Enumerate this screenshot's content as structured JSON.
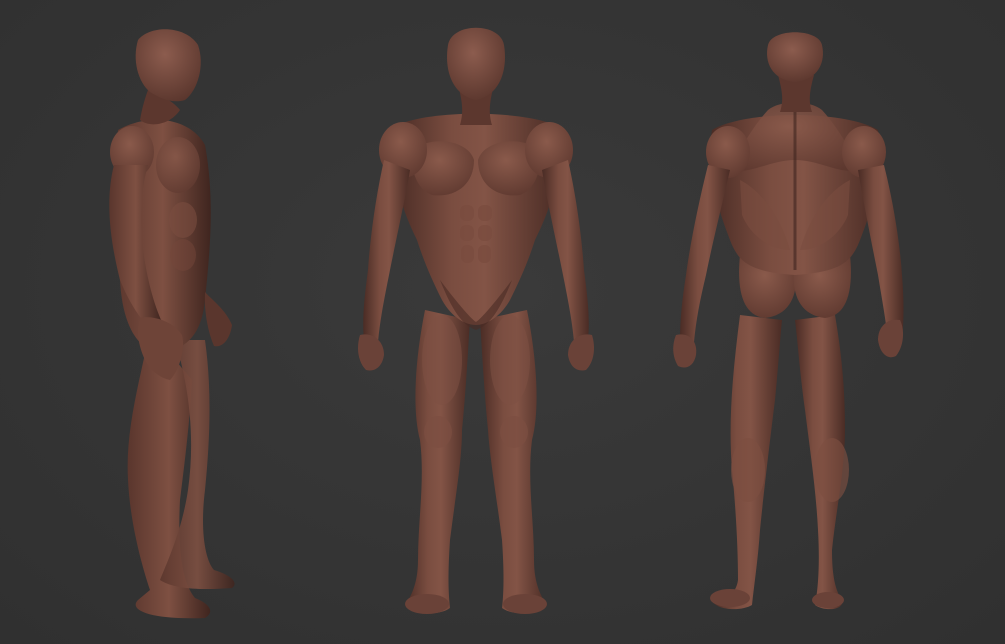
{
  "scene": {
    "background": "#353535",
    "skin_base": "#6a4238",
    "skin_light": "#8a5a4c",
    "skin_dark": "#3e2520"
  },
  "figures": [
    {
      "view": "side",
      "icon": "anatomy-figure-side-view"
    },
    {
      "view": "front",
      "icon": "anatomy-figure-front-view"
    },
    {
      "view": "back",
      "icon": "anatomy-figure-back-view"
    }
  ]
}
